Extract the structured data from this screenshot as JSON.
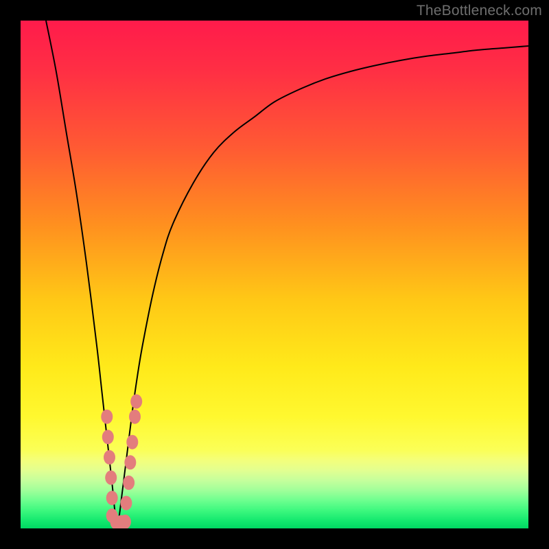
{
  "watermark": "TheBottleneck.com",
  "chart_data": {
    "type": "line",
    "title": "",
    "xlabel": "",
    "ylabel": "",
    "xlim": [
      0,
      100
    ],
    "ylim": [
      0,
      100
    ],
    "optimum_x": 19,
    "series": [
      {
        "name": "bottleneck-curve",
        "x": [
          5,
          7,
          9,
          11,
          13,
          15,
          16,
          17,
          18,
          18.5,
          19,
          19.5,
          20,
          21,
          22,
          23,
          24,
          26,
          28,
          30,
          34,
          38,
          42,
          46,
          50,
          55,
          60,
          65,
          70,
          75,
          80,
          85,
          90,
          95,
          100
        ],
        "y": [
          100,
          90,
          78,
          66,
          52,
          36,
          27,
          18,
          9,
          4,
          0,
          3,
          7,
          15,
          23,
          30,
          36,
          46,
          54,
          60,
          68,
          74,
          78,
          81,
          84,
          86.5,
          88.5,
          90,
          91.2,
          92.2,
          93,
          93.6,
          94.2,
          94.6,
          95
        ]
      }
    ],
    "dots": [
      {
        "x": 17.0,
        "y": 22
      },
      {
        "x": 17.2,
        "y": 18
      },
      {
        "x": 17.5,
        "y": 14
      },
      {
        "x": 17.8,
        "y": 10
      },
      {
        "x": 18.0,
        "y": 6
      },
      {
        "x": 18.0,
        "y": 2.5
      },
      {
        "x": 18.8,
        "y": 1.2
      },
      {
        "x": 19.8,
        "y": 1.2
      },
      {
        "x": 20.6,
        "y": 1.3
      },
      {
        "x": 20.8,
        "y": 5
      },
      {
        "x": 21.3,
        "y": 9
      },
      {
        "x": 21.6,
        "y": 13
      },
      {
        "x": 22.0,
        "y": 17
      },
      {
        "x": 22.5,
        "y": 22
      },
      {
        "x": 22.8,
        "y": 25
      }
    ],
    "gradient_stops": [
      {
        "offset": 0.0,
        "color": "#ff1b4b"
      },
      {
        "offset": 0.1,
        "color": "#ff2f44"
      },
      {
        "offset": 0.25,
        "color": "#ff5a33"
      },
      {
        "offset": 0.4,
        "color": "#ff8f1f"
      },
      {
        "offset": 0.55,
        "color": "#ffc816"
      },
      {
        "offset": 0.68,
        "color": "#ffe91a"
      },
      {
        "offset": 0.78,
        "color": "#fff82f"
      },
      {
        "offset": 0.845,
        "color": "#fbff56"
      },
      {
        "offset": 0.865,
        "color": "#f4ff7a"
      },
      {
        "offset": 0.885,
        "color": "#e3ff90"
      },
      {
        "offset": 0.905,
        "color": "#c6ff9c"
      },
      {
        "offset": 0.925,
        "color": "#a0ff9a"
      },
      {
        "offset": 0.945,
        "color": "#6dff8f"
      },
      {
        "offset": 0.965,
        "color": "#3cf87e"
      },
      {
        "offset": 0.985,
        "color": "#13e96e"
      },
      {
        "offset": 1.0,
        "color": "#00d863"
      }
    ],
    "dot_color": "#e37d7d",
    "curve_color": "#000000"
  }
}
